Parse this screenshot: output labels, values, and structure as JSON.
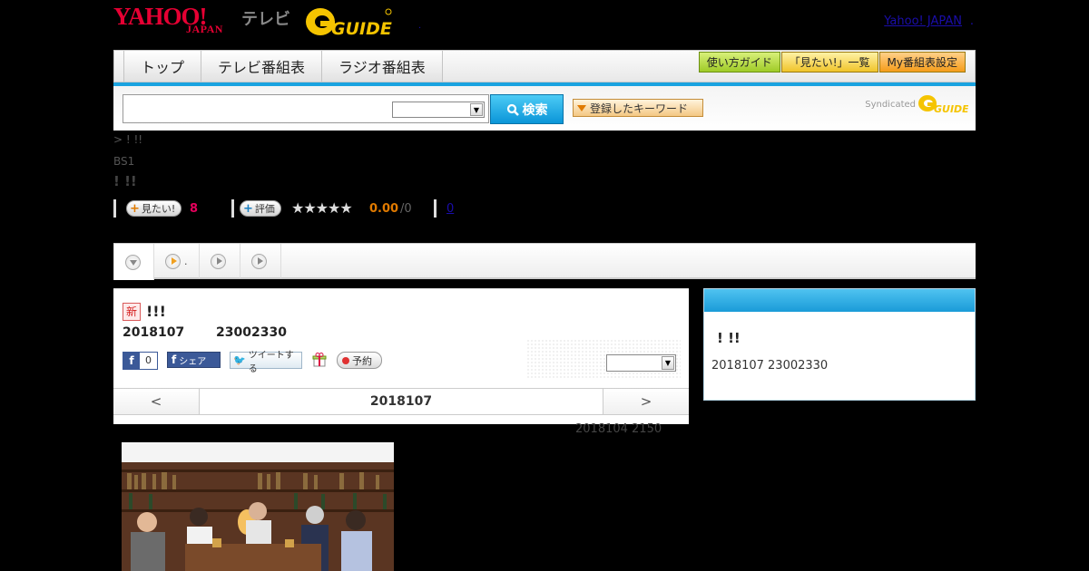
{
  "header": {
    "yahoo_logo": "YAHOO!",
    "japan_logo": "JAPAN",
    "tv_label": "テレビ",
    "gguide_logo": "G-GUIDE",
    "yahoo_japan_link": "Yahoo! JAPAN",
    "link_dot": ".",
    "center_dot": "."
  },
  "nav": {
    "tabs": [
      "トップ",
      "テレビ番組表",
      "ラジオ番組表"
    ],
    "guide_button": "使い方ガイド",
    "wishlist_button": "「見たい!」一覧",
    "my_schedule_button": "My番組表設定"
  },
  "search": {
    "input_value": "",
    "select_value": "",
    "search_button": "検索",
    "keyword_button": "登録したキーワード",
    "syndicated_text": "Syndicated",
    "syndicated_logo": "G-GUIDE"
  },
  "program": {
    "breadcrumb": "> ! !!",
    "channel": "BS1",
    "title": "! !!",
    "want_button": "見たい!",
    "want_count": "8",
    "rate_button": "評価",
    "stars": "★★★★★",
    "score": "0.00",
    "score_count": "/0",
    "review_link": "0"
  },
  "tabstrip": {
    "tab2_label": "."
  },
  "main": {
    "new_badge": "新",
    "title": "!!!",
    "date": "2018107",
    "time": "23002330",
    "fb_like_count": "0",
    "fb_share": "シェア",
    "tweet": "ツイートする",
    "reserve": "予約",
    "select_value": "",
    "pager_prev": "<",
    "pager_date": "2018107",
    "pager_next": ">",
    "air_note": "2018104  2150"
  },
  "side": {
    "title": "! !!",
    "info": "2018107  23002330"
  },
  "icons": {
    "search": "magnifier-icon",
    "facebook": "facebook-icon",
    "twitter": "twitter-bird-icon",
    "gift": "gift-icon",
    "reserve_dot": "record-dot-icon"
  },
  "colors": {
    "yahoo_red": "#e60033",
    "accent_blue": "#1aa3e0",
    "want_pink": "#e6005c",
    "score_orange": "#e07a00",
    "gguide_yellow": "#f5c400"
  }
}
